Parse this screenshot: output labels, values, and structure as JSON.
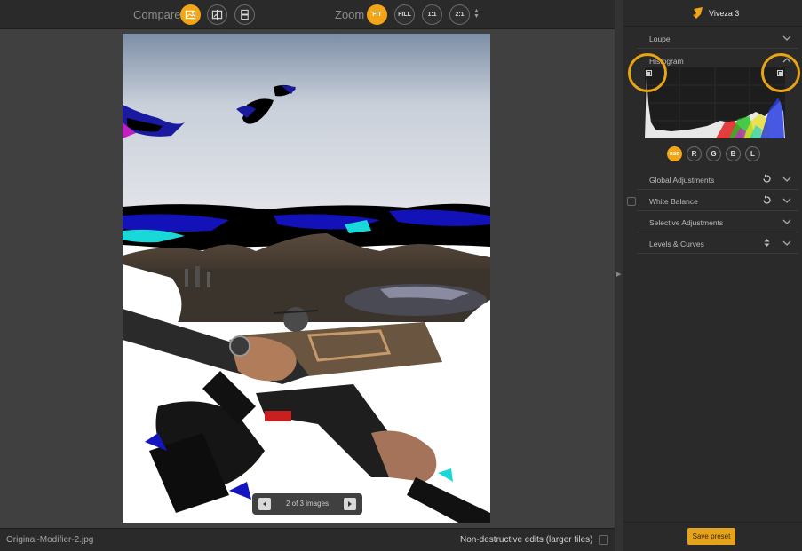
{
  "toolbar": {
    "compare_label": "Compare",
    "zoom_label": "Zoom",
    "zoom_fit": "FIT",
    "zoom_fill": "FILL",
    "zoom_1_1": "1:1",
    "zoom_2_1": "2:1"
  },
  "pager": {
    "text": "2 of 3 images"
  },
  "status": {
    "filename": "Original-Modifier-2.jpg",
    "nondestructive_label": "Non-destructive edits (larger files)"
  },
  "panel": {
    "app_name": "Viveza 3",
    "sections": {
      "loupe": "Loupe",
      "histogram": "Histogram",
      "global": "Global Adjustments",
      "white_balance": "White Balance",
      "selective": "Selective Adjustments",
      "levels": "Levels & Curves"
    },
    "channels": [
      "RGB",
      "R",
      "G",
      "B",
      "L"
    ],
    "save_preset": "Save preset"
  },
  "colors": {
    "accent": "#f2a516",
    "highlight_ring": "#e8a317"
  }
}
